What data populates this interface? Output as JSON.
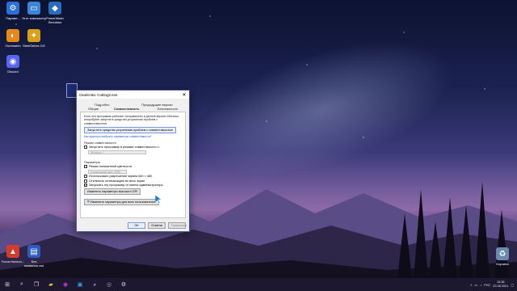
{
  "desktop": {
    "icons": [
      {
        "name": "settings-app-icon",
        "label": "Параме...",
        "glyph": "⚙",
        "color": "#2b6fd6"
      },
      {
        "name": "this-pc-app-icon",
        "label": "Этот компьютер",
        "glyph": "▭",
        "color": "#3c84d6"
      },
      {
        "name": "powerwash-app-icon",
        "label": "PowerWash Simulator",
        "glyph": "◆",
        "color": "#2a6ebb"
      },
      {
        "name": "overwatch-app-icon",
        "label": "Overwatch",
        "glyph": "◐",
        "color": "#e58a1a"
      },
      {
        "name": "steelseries-app-icon",
        "label": "SteelSeries GG",
        "glyph": "✦",
        "color": "#d9a01a"
      },
      {
        "name": "discord-app-icon",
        "label": "Discord",
        "glyph": "◉",
        "color": "#5865f2"
      },
      {
        "name": "forza-app-icon",
        "label": "Forza Horizon...",
        "glyph": "▲",
        "color": "#d33b2a"
      },
      {
        "name": "vsd-file-icon",
        "label": "Без названия.vsd",
        "glyph": "▤",
        "color": "#2f5bbf"
      },
      {
        "name": "recycle-bin-icon",
        "label": "Корзина",
        "glyph": "♻",
        "color": "#6a8ab0"
      }
    ]
  },
  "dialog": {
    "title": "Свойства: Cutting2.exe",
    "close_label": "✕",
    "tabs": {
      "general": "Общие",
      "details": "Подробно",
      "compatibility": "Совместимость",
      "prev_versions": "Предыдущие версии",
      "security": "Безопасность"
    },
    "intro_text": "Если эта программа работает неправильно в данной версии Windows, попробуйте запустить средство устранения проблем с совместимостью.",
    "troubleshooter_button": "Запустить средство устранения проблем с совместимостью",
    "manual_link": "Как вручную выбрать параметры совместимости?",
    "compat_mode": {
      "heading": "Режим совместимости",
      "checkbox_label": "Запустить программу в режиме совместимости с:",
      "select_value": "Windows 7"
    },
    "params": {
      "heading": "Параметры",
      "reduced_color": "Режим пониженной цветности",
      "color_select": "8-разрядный цвет (256)",
      "resolution_640": "Использовать разрешение экрана 640 × 480",
      "disable_fullscreen": "Отключить оптимизацию во весь экран",
      "run_as_admin": "Запускать эту программу от имени администратора",
      "high_dpi_button": "Изменить параметры высокого DPI"
    },
    "all_users_button": "Изменить параметры для всех пользователей",
    "footer": {
      "ok": "ОК",
      "cancel": "Отмена",
      "apply": "Применить"
    }
  },
  "taskbar": {
    "start_icon": "windows-start-icon",
    "items": [
      "search-icon",
      "task-view-icon",
      "explorer-icon",
      "edge-icon",
      "store-icon",
      "discord-icon",
      "steam-icon",
      "settings-icon"
    ],
    "lang": "РУС",
    "time": "13:36",
    "date": "22.08.2021"
  },
  "colors": {
    "accent": "#1a5cc8",
    "taskbar": "#1c1830",
    "window_border": "#4a5a9a"
  }
}
